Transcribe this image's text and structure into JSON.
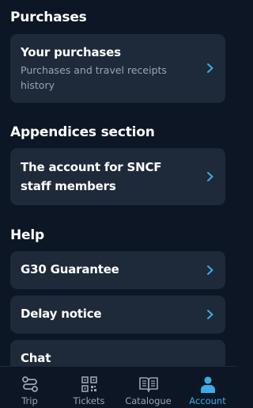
{
  "sections": {
    "purchases": {
      "title": "Purchases",
      "card": {
        "title": "Your purchases",
        "subtitle": "Purchases and travel receipts history"
      }
    },
    "appendices": {
      "title": "Appendices section",
      "card": {
        "title": "The account for SNCF staff members"
      }
    },
    "help": {
      "title": "Help",
      "items": [
        {
          "label": "G30 Guarantee"
        },
        {
          "label": "Delay notice"
        },
        {
          "label": "Chat"
        }
      ]
    }
  },
  "tabbar": {
    "tabs": [
      {
        "label": "Trip",
        "icon": "route-icon"
      },
      {
        "label": "Tickets",
        "icon": "qr-code-icon"
      },
      {
        "label": "Catalogue",
        "icon": "book-icon"
      },
      {
        "label": "Account",
        "icon": "person-icon"
      }
    ],
    "active": "Account",
    "active_color": "#3aaee5"
  }
}
